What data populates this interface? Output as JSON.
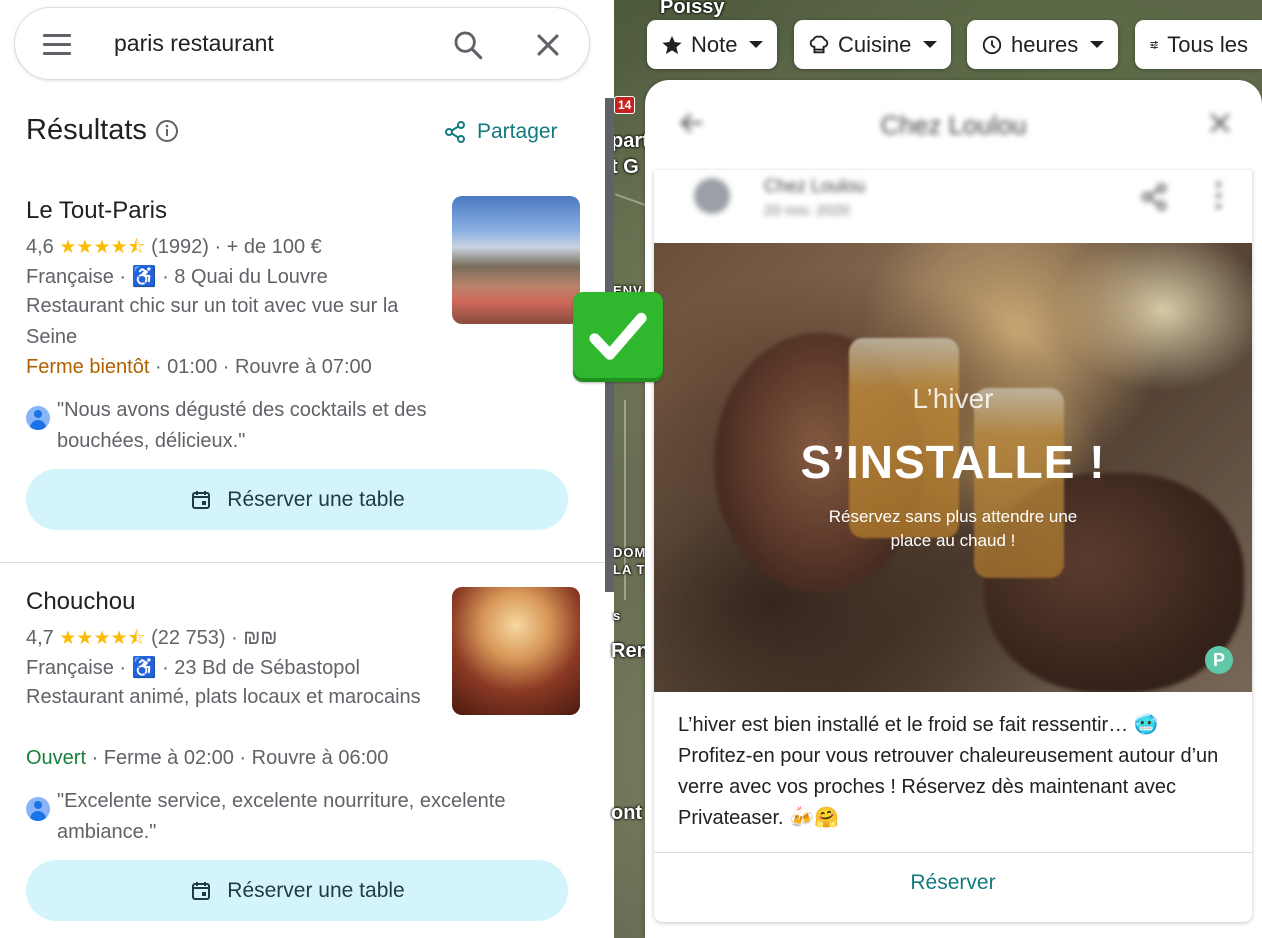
{
  "search": {
    "query": "paris restaurant"
  },
  "results": {
    "title": "Résultats",
    "share_label": "Partager"
  },
  "places": [
    {
      "name": "Le Tout-Paris",
      "rating": "4,6",
      "stars": "★★★★⯪",
      "reviews_price": "(1992) · + de 100 €",
      "cuisine": "Française ·",
      "address": "· 8 Quai du Louvre",
      "description": "Restaurant chic sur un toit avec vue sur la Seine",
      "status": "Ferme bientôt",
      "hours": "· 01:00 · Rouvre à 07:00",
      "review": "\"Nous avons dégusté des cocktails et des bouchées, délicieux.\"",
      "reserve_label": "Réserver une table"
    },
    {
      "name": "Chouchou",
      "rating": "4,7",
      "stars": "★★★★⯪",
      "reviews_price": "(22 753) · ₪₪",
      "cuisine": "Française ·",
      "address": "· 23 Bd de Sébastopol",
      "description": "Restaurant animé, plats locaux et marocains",
      "status": "Ouvert",
      "hours": "· Ferme à 02:00 · Rouvre à 06:00",
      "review": "\"Excelente service, excelente nourriture, excelente ambiance.\"",
      "reserve_label": "Réserver une table"
    }
  ],
  "filters": [
    {
      "label": "Note",
      "icon": "star-icon"
    },
    {
      "label": "Cuisine",
      "icon": "chef-hat-icon"
    },
    {
      "label": "heures",
      "icon": "clock-icon"
    },
    {
      "label": "Tous les",
      "icon": "sliders-icon"
    }
  ],
  "map": {
    "labels": [
      "Poissy",
      "part",
      "t G",
      "ENV",
      "DOM",
      "LA T",
      "s",
      "Ren",
      "ont"
    ],
    "road_shield": "14"
  },
  "post": {
    "header_title": "Chez Loulou",
    "author": "Chez Loulou",
    "date": "20 nov. 2020",
    "image_small": "L’hiver",
    "image_big": "S’INSTALLE !",
    "image_sub_1": "Réservez sans plus attendre une",
    "image_sub_2": "place au chaud !",
    "image_logo": "P",
    "text": "L’hiver est bien installé et le froid se fait ressentir… 🥶 Profitez-en pour vous retrouver chaleureusement autour d’un verre avec vos proches ! Réservez dès maintenant avec Privateaser. 🍻🤗",
    "reserve_label": "Réserver"
  },
  "colors": {
    "accent": "#137a7f",
    "warn": "#b06000",
    "open": "#188038",
    "reserve_bg": "#d4f4fc",
    "check": "#2fb82d"
  }
}
